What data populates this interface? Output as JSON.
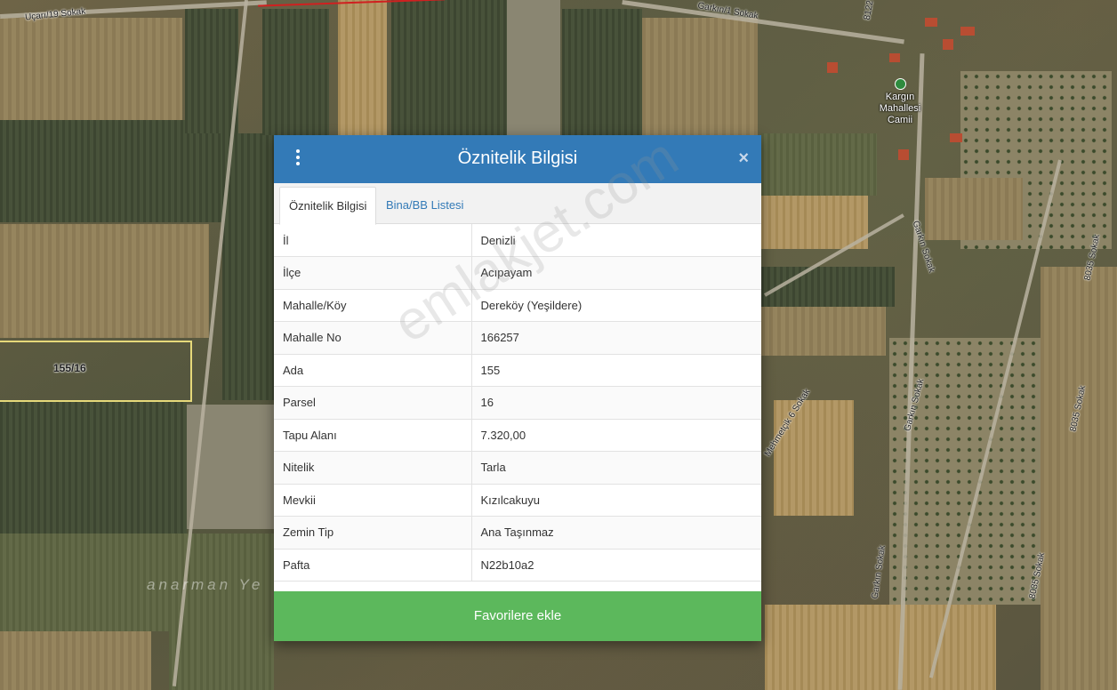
{
  "map": {
    "labels": {
      "ucari": "Uçarı/19 Sokak",
      "garkin1": "Garkın/1 Sokak",
      "r8122": "8122",
      "garkin_sk1": "Garkın Sokak",
      "garkin_sk2": "Garkın Sokak",
      "garkin_sk3": "Garkın Sokak",
      "mehmetcik": "Mehmetçik 6 Sokak",
      "r8035a": "8035 Sokak",
      "r8035b": "8035 Sokak",
      "r8035c": "8035 Sokak",
      "anarman": "anarman Ye"
    },
    "poi": "Kargın Mahallesi Camii",
    "parcel_label": "155/16"
  },
  "modal": {
    "title": "Öznitelik Bilgisi",
    "close_symbol": "×",
    "tabs": [
      "Öznitelik Bilgisi",
      "Bina/BB Listesi"
    ],
    "rows": [
      {
        "key": "İl",
        "value": "Denizli"
      },
      {
        "key": "İlçe",
        "value": "Acıpayam"
      },
      {
        "key": "Mahalle/Köy",
        "value": "Dereköy (Yeşildere)"
      },
      {
        "key": "Mahalle No",
        "value": "166257"
      },
      {
        "key": "Ada",
        "value": "155"
      },
      {
        "key": "Parsel",
        "value": "16"
      },
      {
        "key": "Tapu Alanı",
        "value": "7.320,00"
      },
      {
        "key": "Nitelik",
        "value": "Tarla"
      },
      {
        "key": "Mevkii",
        "value": "Kızılcakuyu"
      },
      {
        "key": "Zemin Tip",
        "value": "Ana Taşınmaz"
      },
      {
        "key": "Pafta",
        "value": "N22b10a2"
      }
    ],
    "favorite_button": "Favorilere ekle"
  },
  "watermark": "emlakjet.com"
}
